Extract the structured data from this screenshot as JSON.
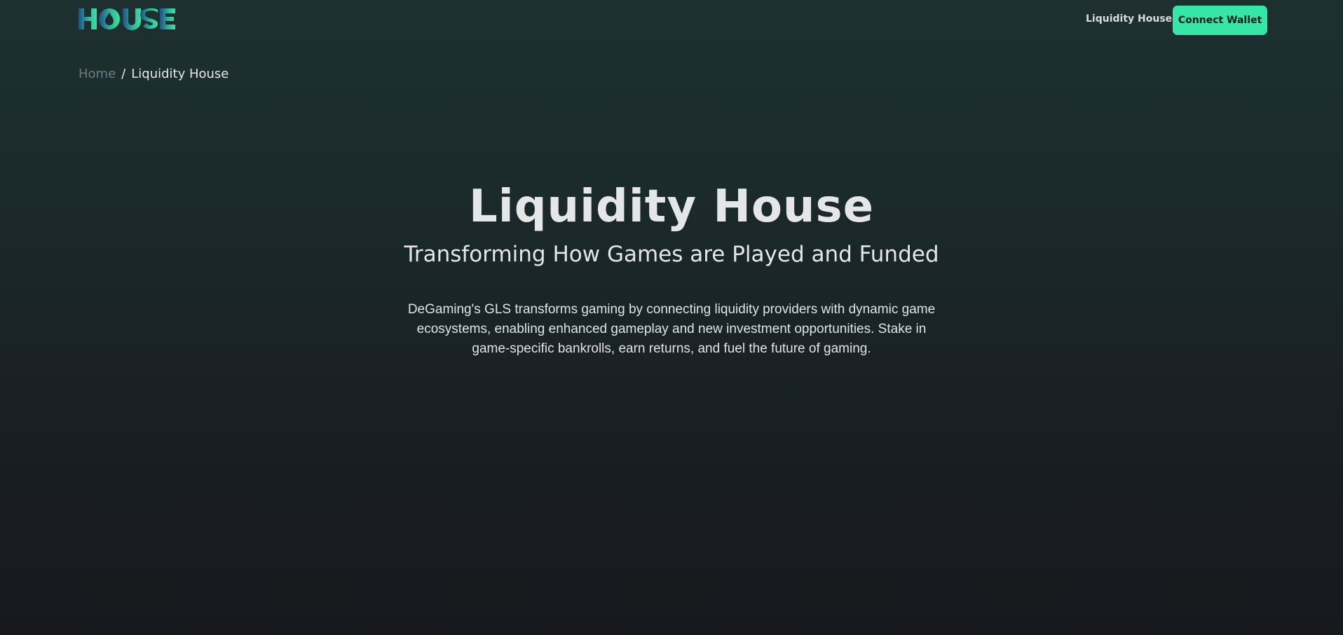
{
  "header": {
    "logo_text": "HOUSE",
    "nav_link": "Liquidity House",
    "connect_button": "Connect Wallet"
  },
  "breadcrumb": {
    "home": "Home",
    "separator": "/",
    "current": "Liquidity House"
  },
  "hero": {
    "title": "Liquidity House",
    "subtitle": "Transforming How Games are Played and Funded",
    "description": "DeGaming's GLS transforms gaming by connecting liquidity providers with dynamic game ecosystems, enabling enhanced gameplay and new investment opportunities. Stake in game-specific bankrolls, earn returns, and fuel the future of gaming."
  },
  "colors": {
    "accent": "#35e6a8",
    "logo_gradient_start": "#1f4f86",
    "logo_gradient_end": "#3fe0a2",
    "background_top": "#1d302f",
    "background_bottom": "#17191d"
  },
  "icons": {
    "logo_drop": "droplet-icon"
  }
}
